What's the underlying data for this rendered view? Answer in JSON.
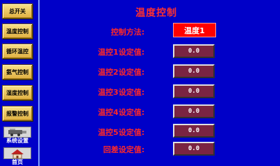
{
  "nav": {
    "power": "总开关",
    "temp": "温度控制",
    "circ": "循环温控",
    "nh3": "氨气控制",
    "light": "湿度控制",
    "alarm": "报警控制",
    "settings": "系统设置",
    "home": "首页"
  },
  "page": {
    "title": "温度控制"
  },
  "mode": {
    "label": "控制方法:",
    "value": "温度1"
  },
  "setpoints": [
    {
      "label": "温控1设定值:",
      "value": "0.0"
    },
    {
      "label": "温控2设定值:",
      "value": "0.0"
    },
    {
      "label": "温控3设定值:",
      "value": "0.0"
    },
    {
      "label": "温控4设定值:",
      "value": "0.0"
    },
    {
      "label": "温控5设定值:",
      "value": "0.0"
    },
    {
      "label": "回差设定值:",
      "value": "0.0"
    }
  ],
  "colors": {
    "background": "#0000c8",
    "label_red": "#ff2828",
    "value_box": "#7a2442",
    "mode_box": "#ff0000"
  },
  "icons": {
    "settings": "machine-icon",
    "home": "house-icon"
  }
}
